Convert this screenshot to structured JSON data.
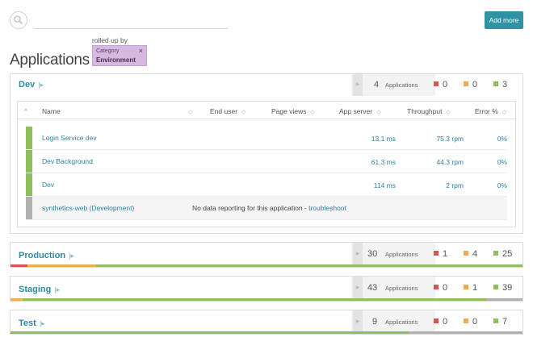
{
  "search": {
    "placeholder": "",
    "icon": "search-icon"
  },
  "header": {
    "add_more_label": "Add more",
    "title": "Applications"
  },
  "rollup": {
    "label": "rolled up by",
    "category_label": "Category",
    "value": "Environment",
    "close_glyph": "×"
  },
  "colors": {
    "accent": "#2f93a5",
    "red": "#d9534f",
    "orange": "#f0ad4e",
    "green": "#8fbf5a",
    "gray": "#b0b0b0"
  },
  "groups": [
    {
      "name": "Dev",
      "count": "4",
      "count_label": "Applications",
      "red": "0",
      "orange": "0",
      "green": "3",
      "expanded": true
    },
    {
      "name": "Production",
      "count": "30",
      "count_label": "Applications",
      "red": "1",
      "orange": "4",
      "green": "25",
      "expanded": false
    },
    {
      "name": "Staging",
      "count": "43",
      "count_label": "Applications",
      "red": "0",
      "orange": "1",
      "green": "39",
      "expanded": false
    },
    {
      "name": "Test",
      "count": "9",
      "count_label": "Applications",
      "red": "0",
      "orange": "0",
      "green": "7",
      "expanded": false
    }
  ],
  "table": {
    "columns": [
      "Name",
      "End user",
      "Page views",
      "App server",
      "Throughput",
      "Error %"
    ],
    "rows": [
      {
        "name": "Login Service dev",
        "app_server": "13.1 ms",
        "throughput": "75.3 rpm",
        "error": "0%",
        "status": "green"
      },
      {
        "name": "Dev Background",
        "app_server": "61.3 ms",
        "throughput": "44.3 rpm",
        "error": "0%",
        "status": "green"
      },
      {
        "name": "Dev",
        "app_server": "114 ms",
        "throughput": "2 rpm",
        "error": "0%",
        "status": "green"
      },
      {
        "name": "synthetics-web (Development)",
        "nodata_text": "No data reporting for this application - ",
        "troubleshoot_label": "troubleshoot",
        "status": "gray"
      }
    ]
  }
}
